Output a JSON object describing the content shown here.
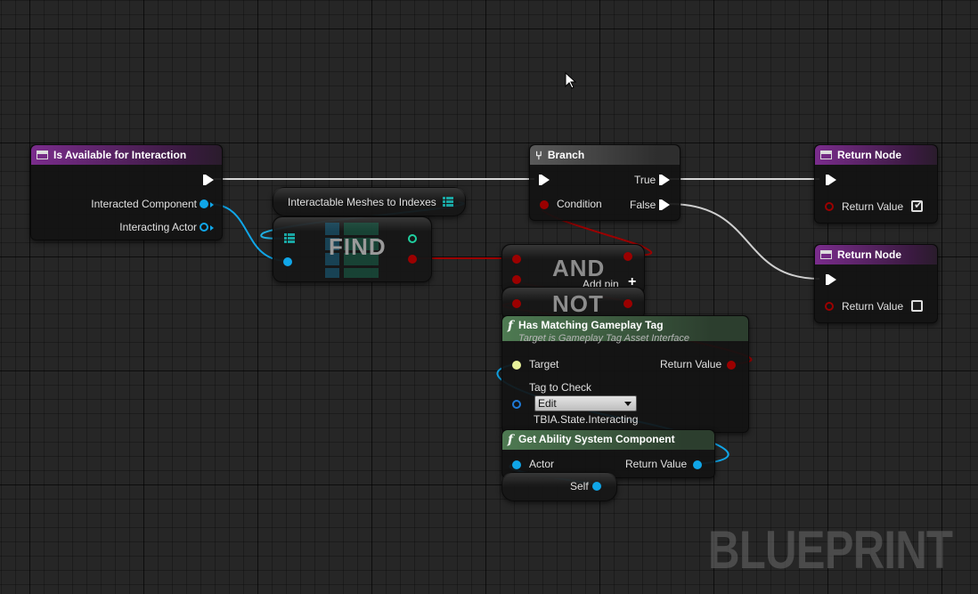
{
  "watermark": "BLUEPRINT",
  "nodes": {
    "entry": {
      "title": "Is Available for Interaction",
      "pins": {
        "interacted_component": "Interacted Component",
        "interacting_actor": "Interacting Actor"
      }
    },
    "meshes": {
      "title": "Interactable Meshes to Indexes"
    },
    "find": {
      "label": "FIND"
    },
    "and": {
      "label": "AND",
      "add_pin": "Add pin",
      "add_pin_icon": "plus-icon"
    },
    "not": {
      "label": "NOT"
    },
    "branch": {
      "title": "Branch",
      "pins": {
        "true": "True",
        "condition": "Condition",
        "false": "False"
      }
    },
    "return_true": {
      "title": "Return Node",
      "return_value_label": "Return Value",
      "return_value": true
    },
    "return_false": {
      "title": "Return Node",
      "return_value_label": "Return Value",
      "return_value": false
    },
    "has_tag": {
      "title": "Has Matching Gameplay Tag",
      "subtitle": "Target is Gameplay Tag Asset Interface",
      "pins": {
        "target": "Target",
        "return_value": "Return Value",
        "tag_to_check": "Tag to Check"
      },
      "tag_dropdown": "Edit",
      "tag_value": "TBIA.State.Interacting"
    },
    "get_asc": {
      "title": "Get Ability System Component",
      "pins": {
        "actor": "Actor",
        "return_value": "Return Value"
      }
    },
    "self": {
      "label": "Self"
    }
  },
  "colors": {
    "exec": "#ffffff",
    "bool": "#9b0000",
    "object": "#10a6e8",
    "interface": "#e8f29b",
    "struct": "#1f7bd8",
    "array": "#1aa7a4",
    "function_header": "#4e7a52",
    "event_header": "#7a2c8c"
  }
}
